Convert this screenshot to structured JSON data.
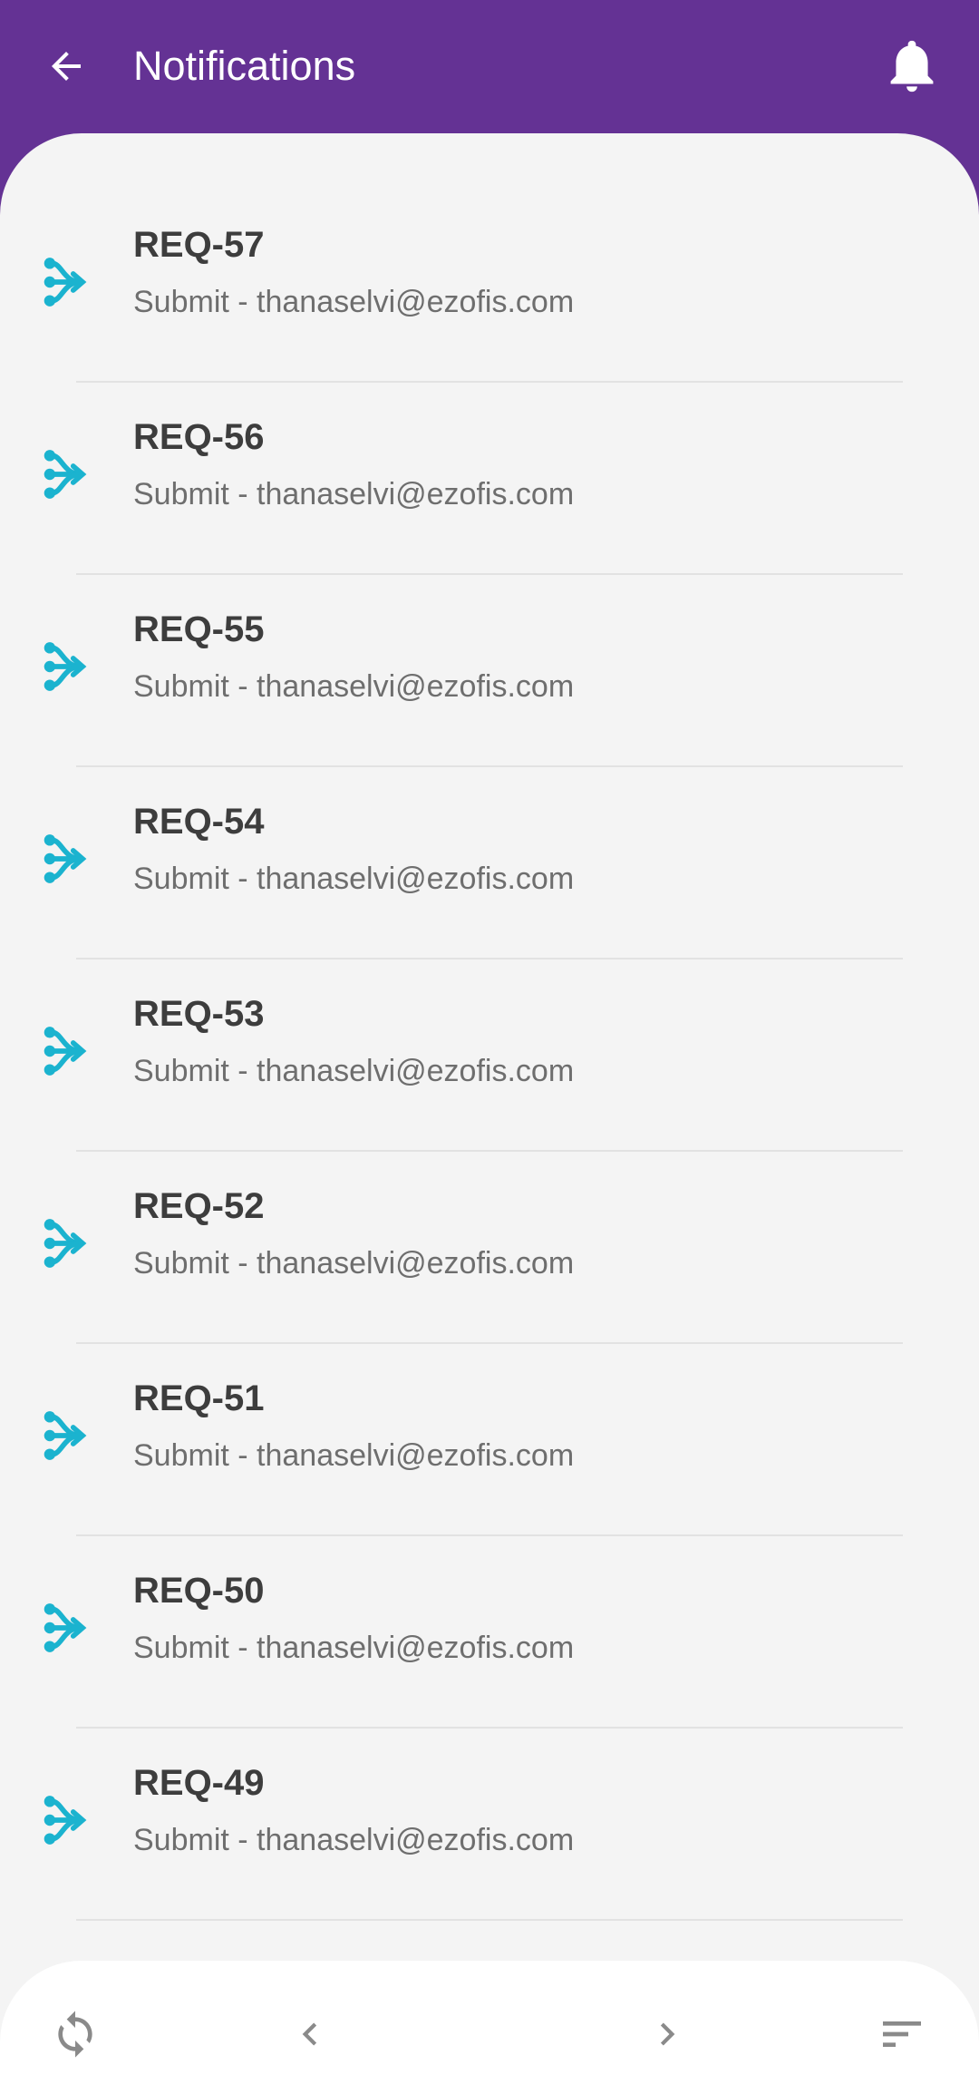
{
  "app_bar": {
    "title": "Notifications",
    "back_icon": "arrow-left-icon",
    "bell_icon": "bell-icon",
    "background_color": "#643294"
  },
  "notifications": [
    {
      "title": "REQ-57",
      "subtitle": "Submit - thanaselvi@ezofis.com",
      "icon": "workflow-icon"
    },
    {
      "title": "REQ-56",
      "subtitle": "Submit - thanaselvi@ezofis.com",
      "icon": "workflow-icon"
    },
    {
      "title": "REQ-55",
      "subtitle": "Submit - thanaselvi@ezofis.com",
      "icon": "workflow-icon"
    },
    {
      "title": "REQ-54",
      "subtitle": "Submit - thanaselvi@ezofis.com",
      "icon": "workflow-icon"
    },
    {
      "title": "REQ-53",
      "subtitle": "Submit - thanaselvi@ezofis.com",
      "icon": "workflow-icon"
    },
    {
      "title": "REQ-52",
      "subtitle": "Submit - thanaselvi@ezofis.com",
      "icon": "workflow-icon"
    },
    {
      "title": "REQ-51",
      "subtitle": "Submit - thanaselvi@ezofis.com",
      "icon": "workflow-icon"
    },
    {
      "title": "REQ-50",
      "subtitle": "Submit - thanaselvi@ezofis.com",
      "icon": "workflow-icon"
    },
    {
      "title": "REQ-49",
      "subtitle": "Submit - thanaselvi@ezofis.com",
      "icon": "workflow-icon"
    }
  ],
  "bottom_bar": {
    "refresh_icon": "refresh-icon",
    "prev_icon": "chevron-left-icon",
    "next_icon": "chevron-right-icon",
    "sort_icon": "sort-icon"
  },
  "colors": {
    "accent": "#1bb3cf",
    "title_text": "#3d3d3d",
    "subtitle_text": "#6e6e6e",
    "content_background": "#f4f4f4",
    "bottom_icon": "#8a8a8a"
  }
}
